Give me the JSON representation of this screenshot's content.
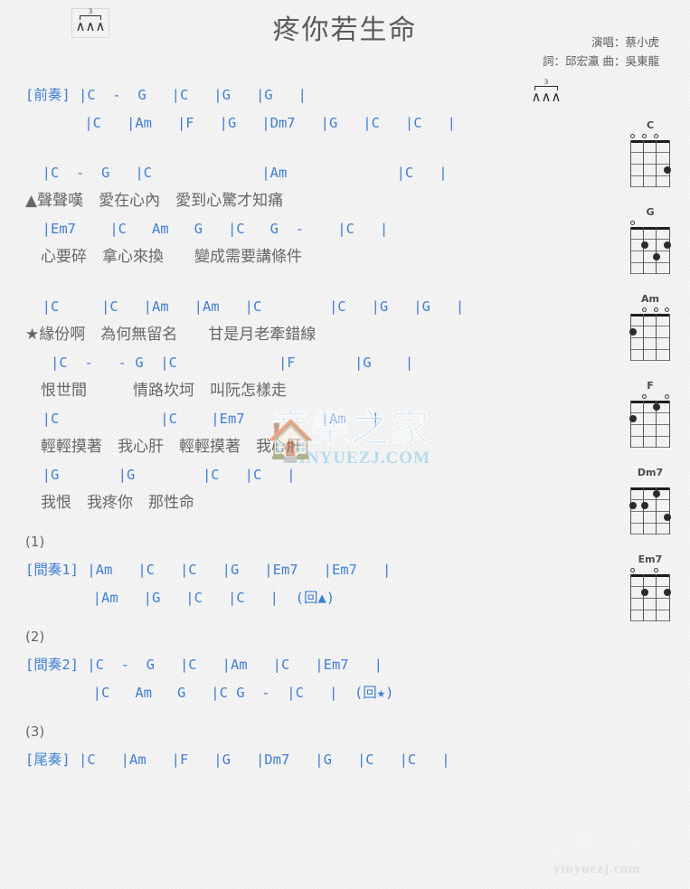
{
  "title": "疼你若生命",
  "credits": {
    "singer": "演唱：蔡小虎",
    "writers": "詞：邱宏瀛  曲：吳東龍"
  },
  "strum_pattern": {
    "tuplet": "3",
    "arrows": "∧∧∧",
    "name": "triplet-strum-pattern"
  },
  "sections": [
    {
      "tag": "[前奏]",
      "lines": [
        {
          "type": "chords",
          "text": "[前奏] |C  -  G   |C   |G   |G   |"
        },
        {
          "type": "chords",
          "text": "       |C   |Am   |F   |G   |Dm7   |G   |C   |C   |"
        }
      ]
    },
    {
      "tag": "",
      "lines": [
        {
          "type": "chords",
          "text": "  |C  -  G   |C             |Am             |C   |"
        },
        {
          "type": "lyrics",
          "text": "▲聲聲嘆　愛在心內　愛到心驚才知痛"
        },
        {
          "type": "chords",
          "text": "  |Em7    |C   Am   G   |C   G  -    |C   |"
        },
        {
          "type": "lyrics",
          "text": "　心要碎　拿心來換　　變成需要講條件"
        }
      ]
    },
    {
      "tag": "",
      "lines": [
        {
          "type": "chords",
          "text": "  |C     |C   |Am   |Am   |C        |C   |G   |G   |"
        },
        {
          "type": "lyrics",
          "text": "★緣份啊　為何無留名　　甘是月老牽錯線"
        },
        {
          "type": "chords",
          "text": "   |C  -   - G  |C            |F       |G    |"
        },
        {
          "type": "lyrics",
          "text": "　恨世間　　　情路坎坷　叫阮怎樣走"
        },
        {
          "type": "chords",
          "text": "  |C            |C    |Em7         |Am   |"
        },
        {
          "type": "lyrics",
          "text": "　輕輕摸著　我心肝　輕輕摸著　我心肝"
        },
        {
          "type": "chords",
          "text": "  |G       |G        |C   |C   |"
        },
        {
          "type": "lyrics",
          "text": "　我恨　我疼你　那性命"
        }
      ]
    },
    {
      "tag": "(1)",
      "lines": [
        {
          "type": "label",
          "text": "(1)"
        },
        {
          "type": "chords",
          "text": "[間奏1] |Am   |C   |C   |G   |Em7   |Em7   |"
        },
        {
          "type": "chords",
          "text": "        |Am   |G   |C   |C   |  (回▲)"
        }
      ]
    },
    {
      "tag": "(2)",
      "lines": [
        {
          "type": "label",
          "text": "(2)"
        },
        {
          "type": "chords",
          "text": "[間奏2] |C  -  G   |C   |Am   |C   |Em7   |"
        },
        {
          "type": "chords",
          "text": "        |C   Am   G   |C G  -  |C   |  (回★)"
        }
      ]
    },
    {
      "tag": "(3)",
      "lines": [
        {
          "type": "label",
          "text": "(3)"
        },
        {
          "type": "chords",
          "text": "[尾奏] |C   |Am   |F   |G   |Dm7   |G   |C   |C   |"
        }
      ]
    }
  ],
  "chord_diagrams": [
    {
      "name": "C",
      "opens": [
        1,
        2,
        3
      ],
      "dots": [
        {
          "string": 4,
          "fret": 3
        }
      ]
    },
    {
      "name": "G",
      "opens": [
        1
      ],
      "dots": [
        {
          "string": 2,
          "fret": 2
        },
        {
          "string": 4,
          "fret": 2
        },
        {
          "string": 3,
          "fret": 3
        }
      ]
    },
    {
      "name": "Am",
      "opens": [
        2,
        3,
        4
      ],
      "dots": [
        {
          "string": 1,
          "fret": 2
        }
      ]
    },
    {
      "name": "F",
      "opens": [
        2,
        4
      ],
      "dots": [
        {
          "string": 3,
          "fret": 1
        },
        {
          "string": 1,
          "fret": 2
        }
      ]
    },
    {
      "name": "Dm7",
      "opens": [],
      "dots": [
        {
          "string": 3,
          "fret": 1
        },
        {
          "string": 1,
          "fret": 2
        },
        {
          "string": 2,
          "fret": 2
        },
        {
          "string": 4,
          "fret": 3
        }
      ]
    },
    {
      "name": "Em7",
      "opens": [
        1,
        3
      ],
      "dots": [
        {
          "string": 2,
          "fret": 2
        },
        {
          "string": 4,
          "fret": 2
        }
      ]
    }
  ],
  "watermarks": {
    "center": {
      "cn": "音樂之家",
      "en": "YINYUEZJ.COM",
      "color": "#86c7ee"
    },
    "bottom": {
      "cn": "音樂之家",
      "en": "yinyuezj.com",
      "color": "#dcdcdc"
    }
  }
}
